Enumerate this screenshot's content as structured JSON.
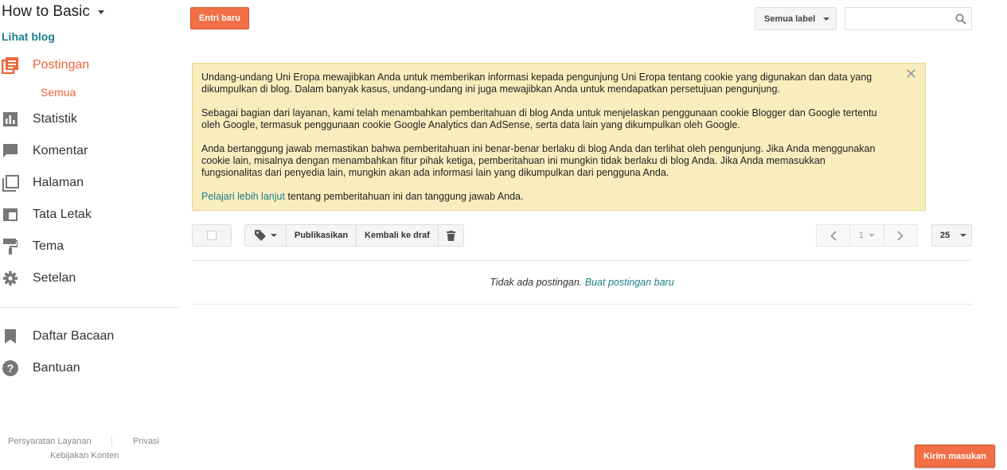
{
  "colors": {
    "accent": "#f26f45",
    "link": "#1c7d8a",
    "notice_bg": "#f9edbe"
  },
  "sidebar": {
    "blog_title": "How to Basic",
    "view_blog": "Lihat blog",
    "items": [
      {
        "label": "Postingan",
        "icon": "posts-icon",
        "active": true
      },
      {
        "label": "Statistik",
        "icon": "stats-icon"
      },
      {
        "label": "Komentar",
        "icon": "comments-icon"
      },
      {
        "label": "Halaman",
        "icon": "pages-icon"
      },
      {
        "label": "Tata Letak",
        "icon": "layout-icon"
      },
      {
        "label": "Tema",
        "icon": "theme-icon"
      },
      {
        "label": "Setelan",
        "icon": "settings-icon"
      },
      {
        "label": "Daftar Bacaan",
        "icon": "bookmark-icon"
      },
      {
        "label": "Bantuan",
        "icon": "help-icon"
      }
    ],
    "sub_item": "Semua",
    "footer": {
      "terms": "Persyaratan Layanan",
      "privacy": "Privasi",
      "content_policy": "Kebijakan Konten"
    }
  },
  "toolbar": {
    "new_post": "Entri baru",
    "label_filter": "Semua label",
    "search_placeholder": ""
  },
  "notice": {
    "p1": "Undang-undang Uni Eropa mewajibkan Anda untuk memberikan informasi kepada pengunjung Uni Eropa tentang cookie yang digunakan dan data yang dikumpulkan di blog. Dalam banyak kasus, undang-undang ini juga mewajibkan Anda untuk mendapatkan persetujuan pengunjung.",
    "p2": "Sebagai bagian dari layanan, kami telah menambahkan pemberitahuan di blog Anda untuk menjelaskan penggunaan cookie Blogger dan Google tertentu oleh Google, termasuk penggunaan cookie Google Analytics dan AdSense, serta data lain yang dikumpulkan oleh Google.",
    "p3": "Anda bertanggung jawab memastikan bahwa pemberitahuan ini benar-benar berlaku di blog Anda dan terlihat oleh pengunjung. Jika Anda menggunakan cookie lain, misalnya dengan menambahkan fitur pihak ketiga, pemberitahuan ini mungkin tidak berlaku di blog Anda. Jika Anda memasukkan fungsionalitas dari penyedia lain, mungkin akan ada informasi lain yang dikumpulkan dari pengguna Anda.",
    "learn_more": "Pelajari lebih lanjut",
    "p4_rest": " tentang pemberitahuan ini dan tanggung jawab Anda.",
    "close": "✕"
  },
  "posts_toolbar": {
    "publish": "Publikasikan",
    "revert_draft": "Kembali ke draf",
    "page": "1",
    "per_page": "25"
  },
  "empty": {
    "message": "Tidak ada postingan.",
    "create_link": "Buat postingan baru"
  },
  "feedback": "Kirim masukan"
}
